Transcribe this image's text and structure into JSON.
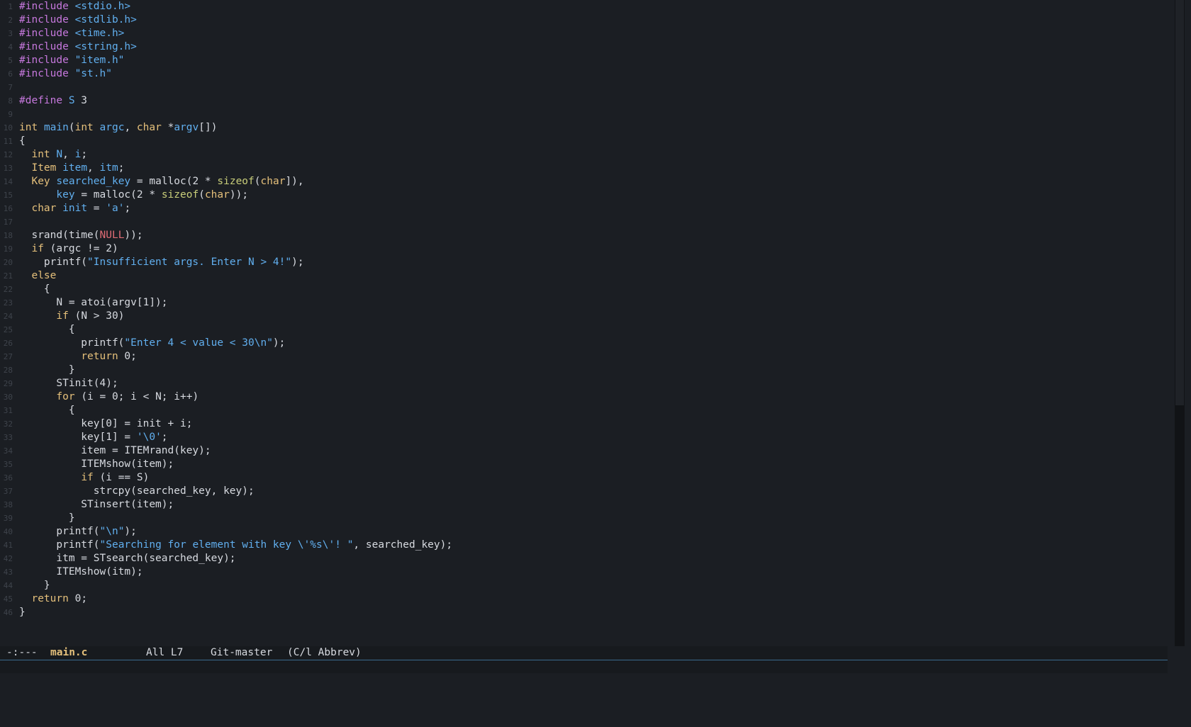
{
  "editor": {
    "filename": "main.c",
    "lines": [
      [
        [
          "pp",
          "#include "
        ],
        [
          "str",
          "<stdio.h>"
        ]
      ],
      [
        [
          "pp",
          "#include "
        ],
        [
          "str",
          "<stdlib.h>"
        ]
      ],
      [
        [
          "pp",
          "#include "
        ],
        [
          "str",
          "<time.h>"
        ]
      ],
      [
        [
          "pp",
          "#include "
        ],
        [
          "str",
          "<string.h>"
        ]
      ],
      [
        [
          "pp",
          "#include "
        ],
        [
          "str",
          "\"item.h\""
        ]
      ],
      [
        [
          "pp",
          "#include "
        ],
        [
          "str",
          "\"st.h\""
        ]
      ],
      [],
      [
        [
          "pp",
          "#define "
        ],
        [
          "var",
          "S"
        ],
        [
          "plain",
          " 3"
        ]
      ],
      [],
      [
        [
          "type",
          "int"
        ],
        [
          "plain",
          " "
        ],
        [
          "fn",
          "main"
        ],
        [
          "plain",
          "("
        ],
        [
          "type",
          "int"
        ],
        [
          "plain",
          " "
        ],
        [
          "var",
          "argc"
        ],
        [
          "plain",
          ", "
        ],
        [
          "type",
          "char"
        ],
        [
          "plain",
          " *"
        ],
        [
          "var",
          "argv"
        ],
        [
          "plain",
          "[])"
        ]
      ],
      [
        [
          "plain",
          "{"
        ]
      ],
      [
        [
          "plain",
          "  "
        ],
        [
          "type",
          "int"
        ],
        [
          "plain",
          " "
        ],
        [
          "var",
          "N"
        ],
        [
          "plain",
          ", "
        ],
        [
          "var",
          "i"
        ],
        [
          "plain",
          ";"
        ]
      ],
      [
        [
          "plain",
          "  "
        ],
        [
          "type",
          "Item"
        ],
        [
          "plain",
          " "
        ],
        [
          "var",
          "item"
        ],
        [
          "plain",
          ", "
        ],
        [
          "var",
          "itm"
        ],
        [
          "plain",
          ";"
        ]
      ],
      [
        [
          "plain",
          "  "
        ],
        [
          "type",
          "Key"
        ],
        [
          "plain",
          " "
        ],
        [
          "var",
          "searched_key"
        ],
        [
          "plain",
          " = malloc(2 * "
        ],
        [
          "builtin",
          "sizeof"
        ],
        [
          "plain",
          "("
        ],
        [
          "type",
          "char"
        ],
        [
          "plain",
          "]),"
        ]
      ],
      [
        [
          "plain",
          "      "
        ],
        [
          "var",
          "key"
        ],
        [
          "plain",
          " = malloc(2 * "
        ],
        [
          "builtin",
          "sizeof"
        ],
        [
          "plain",
          "("
        ],
        [
          "type",
          "char"
        ],
        [
          "plain",
          "));"
        ]
      ],
      [
        [
          "plain",
          "  "
        ],
        [
          "type",
          "char"
        ],
        [
          "plain",
          " "
        ],
        [
          "var",
          "init"
        ],
        [
          "plain",
          " = "
        ],
        [
          "str",
          "'a'"
        ],
        [
          "plain",
          ";"
        ]
      ],
      [],
      [
        [
          "plain",
          "  srand(time("
        ],
        [
          "const",
          "NULL"
        ],
        [
          "plain",
          "));"
        ]
      ],
      [
        [
          "plain",
          "  "
        ],
        [
          "kw",
          "if"
        ],
        [
          "plain",
          " (argc != 2)"
        ]
      ],
      [
        [
          "plain",
          "    printf("
        ],
        [
          "str",
          "\"Insufficient args. Enter N > 4!\""
        ],
        [
          "plain",
          ");"
        ]
      ],
      [
        [
          "plain",
          "  "
        ],
        [
          "kw",
          "else"
        ]
      ],
      [
        [
          "plain",
          "    {"
        ]
      ],
      [
        [
          "plain",
          "      N = atoi(argv[1]);"
        ]
      ],
      [
        [
          "plain",
          "      "
        ],
        [
          "kw",
          "if"
        ],
        [
          "plain",
          " (N > 30)"
        ]
      ],
      [
        [
          "plain",
          "        {"
        ]
      ],
      [
        [
          "plain",
          "          printf("
        ],
        [
          "str",
          "\"Enter 4 < value < 30\\n\""
        ],
        [
          "plain",
          ");"
        ]
      ],
      [
        [
          "plain",
          "          "
        ],
        [
          "kw",
          "return"
        ],
        [
          "plain",
          " 0;"
        ]
      ],
      [
        [
          "plain",
          "        }"
        ]
      ],
      [
        [
          "plain",
          "      STinit(4);"
        ]
      ],
      [
        [
          "plain",
          "      "
        ],
        [
          "kw",
          "for"
        ],
        [
          "plain",
          " (i = 0; i < N; i++)"
        ]
      ],
      [
        [
          "plain",
          "        {"
        ]
      ],
      [
        [
          "plain",
          "          key[0] = init + i;"
        ]
      ],
      [
        [
          "plain",
          "          key[1] = "
        ],
        [
          "str",
          "'\\0'"
        ],
        [
          "plain",
          ";"
        ]
      ],
      [
        [
          "plain",
          "          item = ITEMrand(key);"
        ]
      ],
      [
        [
          "plain",
          "          ITEMshow(item);"
        ]
      ],
      [
        [
          "plain",
          "          "
        ],
        [
          "kw",
          "if"
        ],
        [
          "plain",
          " (i == S)"
        ]
      ],
      [
        [
          "plain",
          "            strcpy(searched_key, key);"
        ]
      ],
      [
        [
          "plain",
          "          STinsert(item);"
        ]
      ],
      [
        [
          "plain",
          "        }"
        ]
      ],
      [
        [
          "plain",
          "      printf("
        ],
        [
          "str",
          "\"\\n\""
        ],
        [
          "plain",
          ");"
        ]
      ],
      [
        [
          "plain",
          "      printf("
        ],
        [
          "str",
          "\"Searching for element with key \\'%s\\'! \""
        ],
        [
          "plain",
          ", searched_key);"
        ]
      ],
      [
        [
          "plain",
          "      itm = STsearch(searched_key);"
        ]
      ],
      [
        [
          "plain",
          "      ITEMshow(itm);"
        ]
      ],
      [
        [
          "plain",
          "    }"
        ]
      ],
      [
        [
          "plain",
          "  "
        ],
        [
          "kw",
          "return"
        ],
        [
          "plain",
          " 0;"
        ]
      ],
      [
        [
          "plain",
          "}"
        ]
      ]
    ]
  },
  "modeline": {
    "status": "-:---",
    "filename": "main.c",
    "position": "All L7",
    "vcs": "Git-master",
    "modes": "(C/l Abbrev)"
  },
  "colors": {
    "background": "#1b1e23",
    "preprocessor": "#c678dd",
    "string": "#61afef",
    "keyword": "#e5c07b",
    "modeline_filename": "#e5c07b",
    "modeline_border": "#3a6a8e"
  }
}
